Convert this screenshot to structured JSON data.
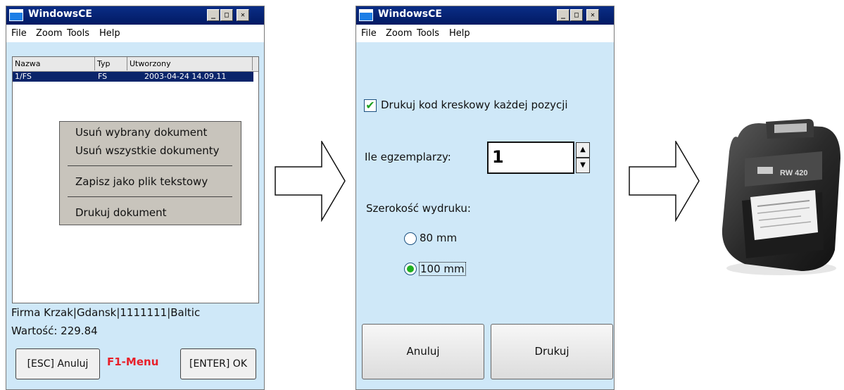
{
  "window1": {
    "title": "WindowsCE",
    "minimize": "_",
    "maximize": "□",
    "close": "✕",
    "menu": [
      "File",
      "Zoom",
      "Tools",
      "Help"
    ],
    "list": {
      "columns": [
        "Nazwa",
        "Typ",
        "Utworzony"
      ],
      "rows": [
        {
          "name": "1/FS",
          "type": "FS",
          "created": "2003-04-24 14.09.11"
        }
      ]
    },
    "context_menu": [
      "Usuń wybrany dokument",
      "Usuń wszystkie dokumenty",
      "Zapisz jako plik tekstowy",
      "Drukuj dokument"
    ],
    "status_line1": "Firma Krzak|Gdansk|1111111|Baltic",
    "status_line2": "Wartość: 229.84",
    "esc_button": "[ESC] Anuluj",
    "f1_label": "F1-Menu",
    "enter_button": "[ENTER] OK"
  },
  "window2": {
    "title": "WindowsCE",
    "minimize": "_",
    "maximize": "□",
    "close": "✕",
    "menu": [
      "File",
      "Zoom",
      "Tools",
      "Help"
    ],
    "checkbox_label": "Drukuj kod kreskowy każdej pozycji",
    "checkbox_checked": true,
    "copies_label": "Ile egzemplarzy:",
    "copies_value": "1",
    "width_label": "Szerokość wydruku:",
    "radio_options": [
      "80 mm",
      "100 mm"
    ],
    "radio_selected": "100 mm",
    "cancel_button": "Anuluj",
    "print_button": "Drukuj"
  },
  "printer": {
    "model_label": "RW 420"
  },
  "colors": {
    "window_bg": "#cfe8f8",
    "title_bar": "#0a2d86",
    "selection": "#0a246a",
    "f1_red": "#e8202a",
    "check_green": "#21a121"
  }
}
